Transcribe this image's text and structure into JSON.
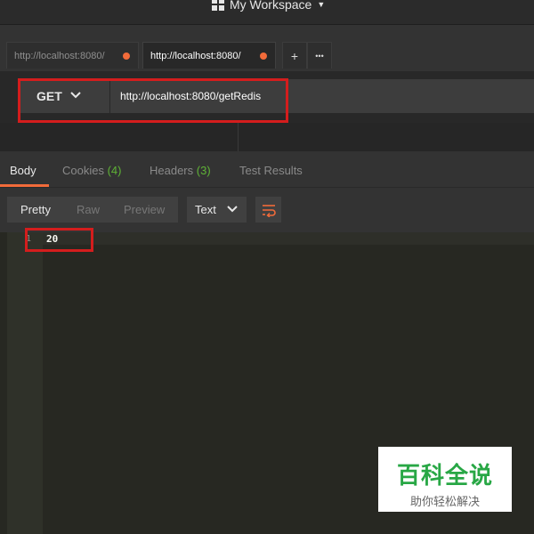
{
  "workspace": {
    "name": "My Workspace"
  },
  "tabs": [
    {
      "label": "http://localhost:8080/",
      "unsaved": true,
      "active": false
    },
    {
      "label": "http://localhost:8080/",
      "unsaved": true,
      "active": true
    }
  ],
  "tab_actions": {
    "add": "+",
    "more": "•••"
  },
  "request": {
    "method": "GET",
    "url": "http://localhost:8080/getRedis"
  },
  "response_tabs": [
    {
      "label": "Body",
      "count": ""
    },
    {
      "label": "Cookies",
      "count": "(4)"
    },
    {
      "label": "Headers",
      "count": "(3)"
    },
    {
      "label": "Test Results",
      "count": ""
    }
  ],
  "view_modes": {
    "pretty": "Pretty",
    "raw": "Raw",
    "preview": "Preview"
  },
  "format": {
    "selected": "Text"
  },
  "body": {
    "line_number": "1",
    "content": "20"
  },
  "watermark": {
    "title": "百科全说",
    "subtitle": "助你轻松解决"
  },
  "colors": {
    "accent": "#f26b3a",
    "highlight": "#d41d1d",
    "count": "#5fb336",
    "watermark": "#28a745"
  }
}
